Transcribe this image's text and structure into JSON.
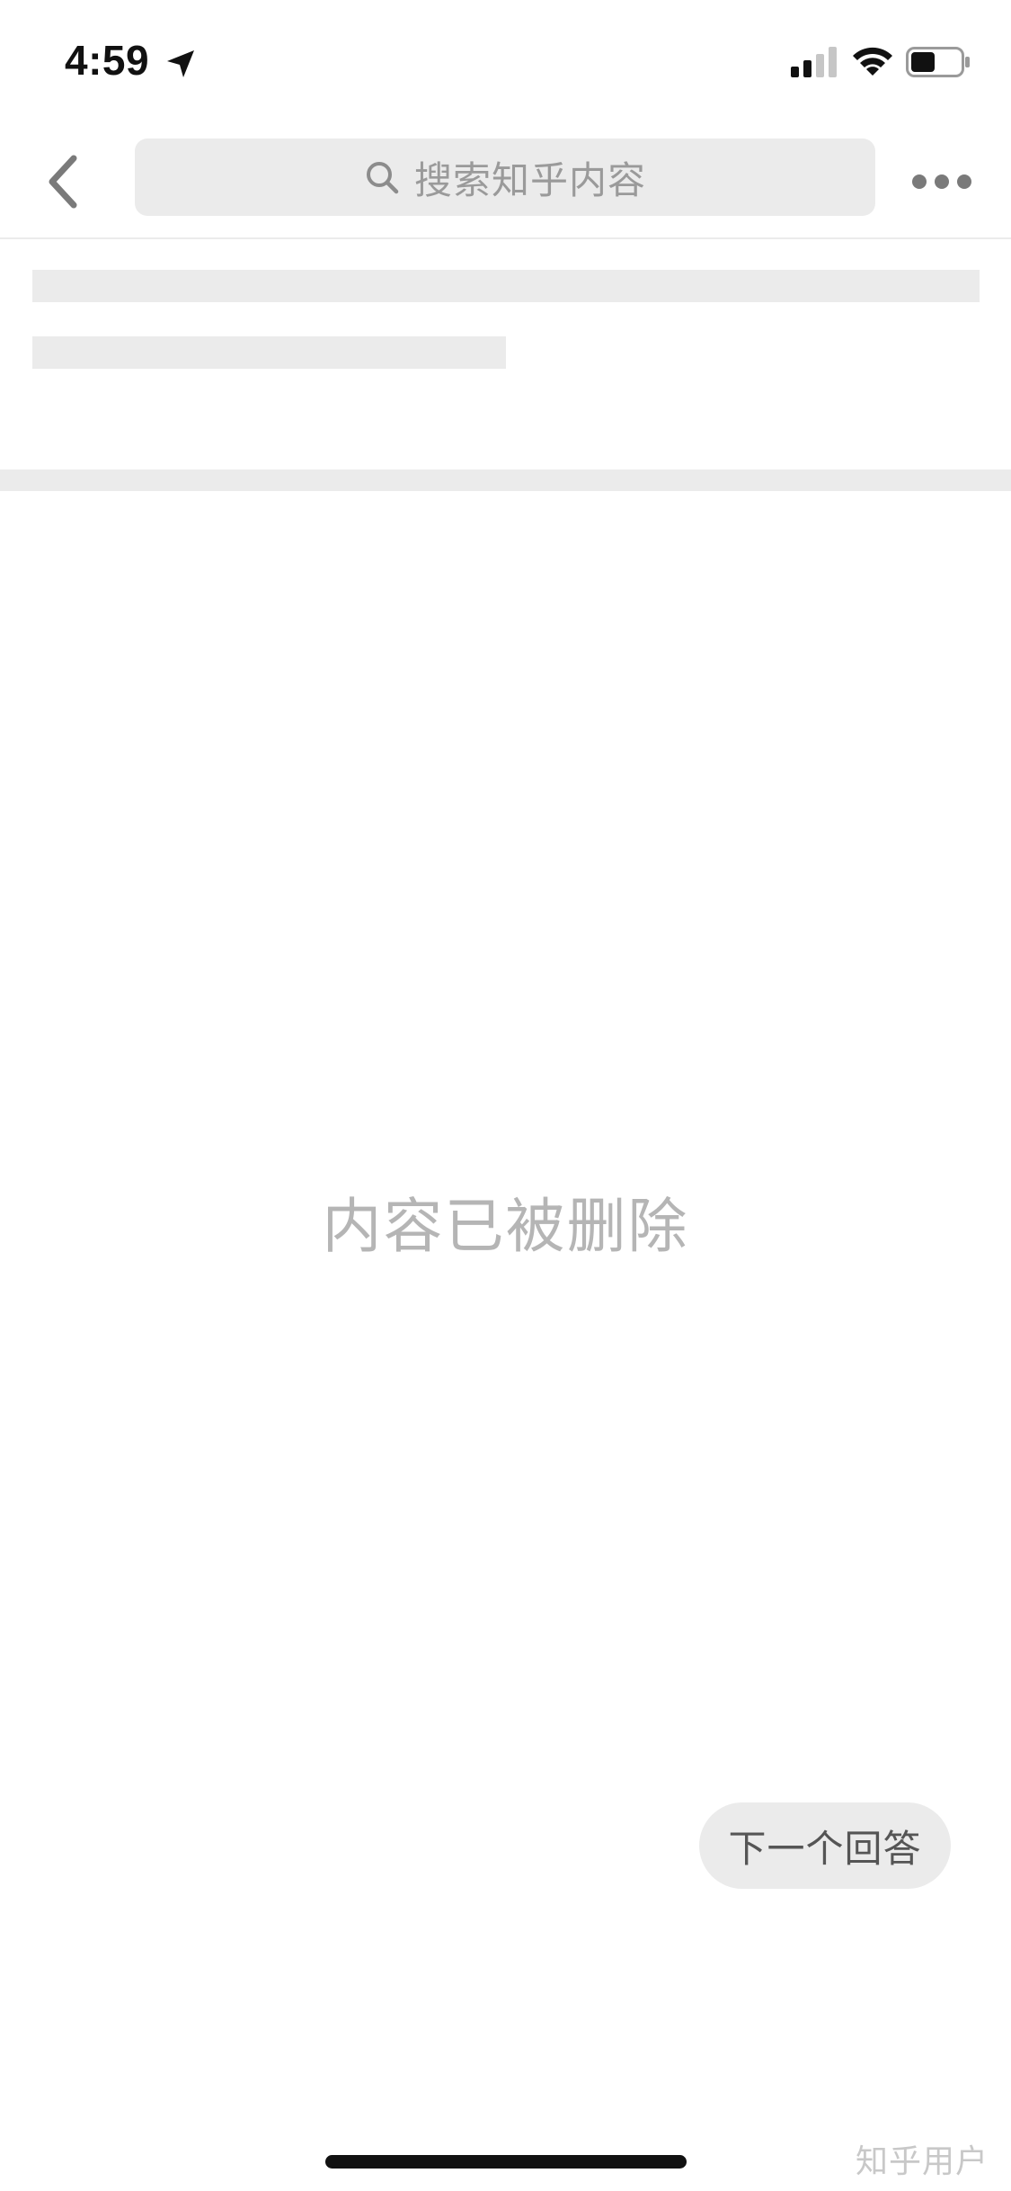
{
  "status_bar": {
    "time": "4:59",
    "icons": [
      "location-arrow-icon",
      "signal-icon",
      "wifi-icon",
      "battery-icon"
    ]
  },
  "nav": {
    "back_icon": "chevron-left-icon",
    "search_placeholder": "搜索知乎内容",
    "more_icon": "more-horizontal-icon"
  },
  "content": {
    "message": "内容已被删除"
  },
  "actions": {
    "next_answer": "下一个回答"
  },
  "watermark": "知乎用户",
  "colors": {
    "skeleton": "#ebebeb",
    "muted_text": "#b5b5b5",
    "icon_gray": "#7a7a7a"
  }
}
